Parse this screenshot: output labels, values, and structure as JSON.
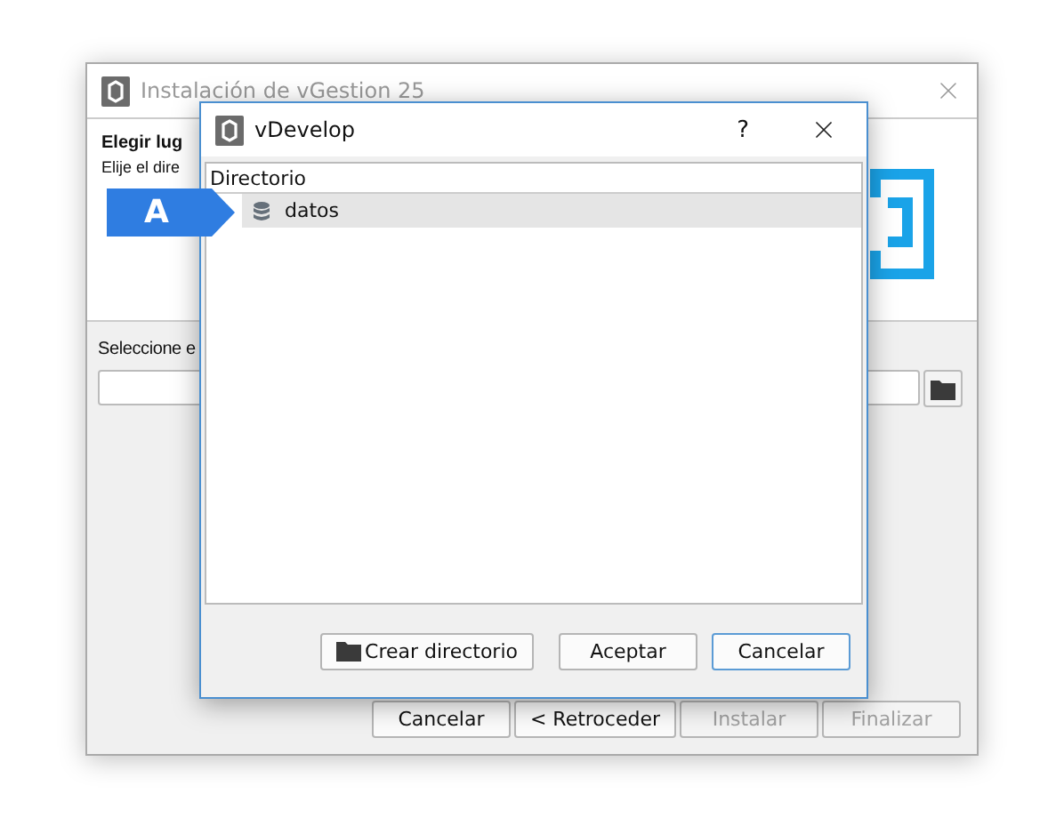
{
  "main_window": {
    "title": "Instalación de vGestion 25",
    "heading": "Elegir lug",
    "description": "Elije el dire",
    "path_label": "Seleccione e",
    "buttons": [
      {
        "label": "Cancelar",
        "disabled": false
      },
      {
        "label": "< Retroceder",
        "disabled": false
      },
      {
        "label": "Instalar",
        "disabled": true
      },
      {
        "label": "Finalizar",
        "disabled": true
      }
    ]
  },
  "dialog": {
    "title": "vDevelop",
    "help": "?",
    "tree": {
      "column": "Directorio",
      "items": [
        {
          "label": "datos",
          "selected": true
        }
      ]
    },
    "buttons": [
      {
        "label": "Crear directorio",
        "kind": "folder",
        "default": false
      },
      {
        "label": "Aceptar",
        "kind": "plain",
        "default": false
      },
      {
        "label": "Cancelar",
        "kind": "plain",
        "default": true
      }
    ]
  },
  "callout": {
    "label": "A"
  }
}
